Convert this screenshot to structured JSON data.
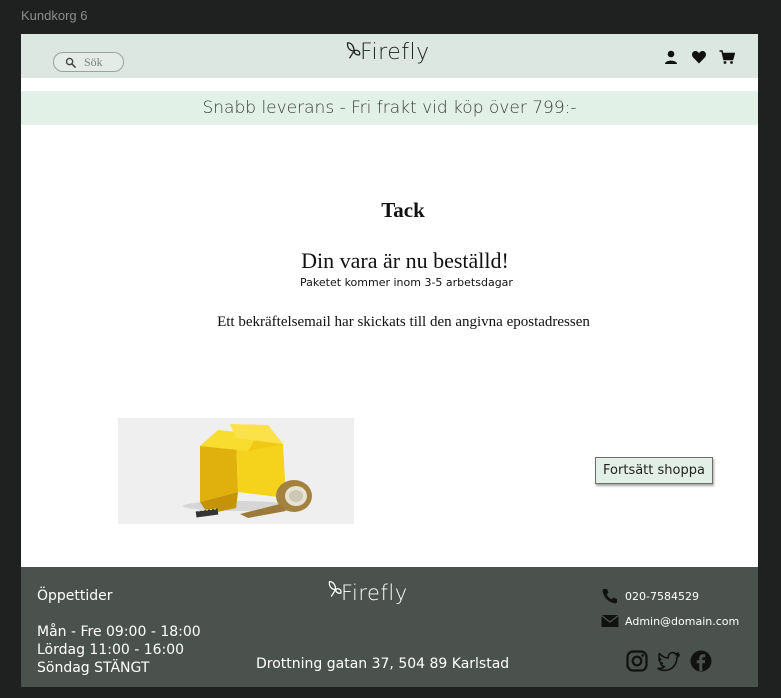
{
  "window": {
    "title": "Kundkorg 6"
  },
  "header": {
    "search_placeholder": "Sök",
    "logo_text": "Firefly",
    "icons": [
      "user-icon",
      "heart-icon",
      "cart-icon"
    ]
  },
  "banner": {
    "text": "Snabb leverans - Fri frakt vid köp över 799:-"
  },
  "main": {
    "thanks": "Tack",
    "ordered": "Din vara är nu beställd!",
    "package_info": "Paketet kommer inom 3-5 arbetsdagar",
    "email_info": "Ett bekräftelsemail har skickats till den angivna epostadressen",
    "continue_label": "Fortsätt shoppa"
  },
  "footer": {
    "hours_title": "Öppettider",
    "hours": [
      "Mån - Fre  09:00 - 18:00",
      "Lördag 11:00 - 16:00",
      "Söndag STÄNGT"
    ],
    "logo_text": "Firefly",
    "address": "Drottning gatan 37,  504 89 Karlstad",
    "phone": "020-7584529",
    "email": "Admin@domain.com",
    "social": [
      "instagram-icon",
      "twitter-icon",
      "facebook-icon"
    ]
  },
  "colors": {
    "header_bg": "#dbe7e0",
    "banner_bg": "#e1f1e7",
    "footer_bg": "#4b524e",
    "button_bg": "#e2efe7"
  }
}
